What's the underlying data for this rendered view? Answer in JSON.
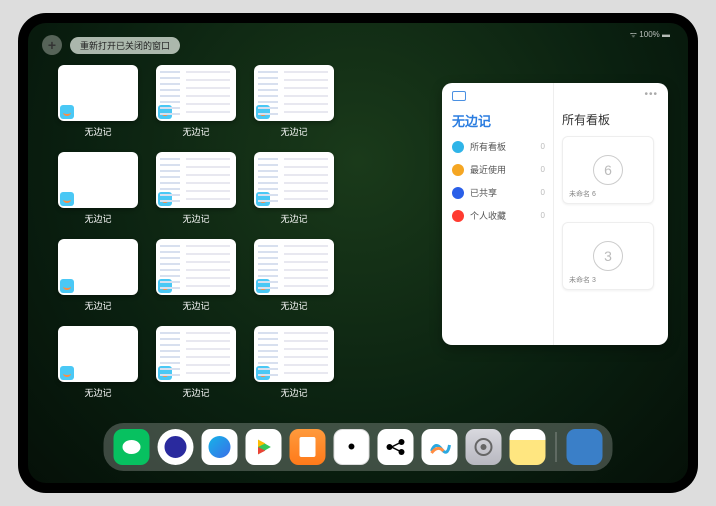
{
  "status": {
    "text": "100%"
  },
  "topbar": {
    "reopen_label": "重新打开已关闭的窗口"
  },
  "app_name": "无边记",
  "tiles": [
    {
      "label": "无边记",
      "variant": "plain"
    },
    {
      "label": "无边记",
      "variant": "detail"
    },
    {
      "label": "无边记",
      "variant": "detail"
    },
    {
      "label": "无边记",
      "variant": "plain"
    },
    {
      "label": "无边记",
      "variant": "detail"
    },
    {
      "label": "无边记",
      "variant": "detail"
    },
    {
      "label": "无边记",
      "variant": "plain"
    },
    {
      "label": "无边记",
      "variant": "detail"
    },
    {
      "label": "无边记",
      "variant": "detail"
    },
    {
      "label": "无边记",
      "variant": "plain"
    },
    {
      "label": "无边记",
      "variant": "detail"
    },
    {
      "label": "无边记",
      "variant": "detail"
    }
  ],
  "panel": {
    "left_title": "无边记",
    "right_title": "所有看板",
    "items": [
      {
        "icon": "grid",
        "color": "#2fb4e8",
        "label": "所有看板",
        "count": "0"
      },
      {
        "icon": "clock",
        "color": "#f5a623",
        "label": "最近使用",
        "count": "0"
      },
      {
        "icon": "share",
        "color": "#2a5fe8",
        "label": "已共享",
        "count": "0"
      },
      {
        "icon": "heart",
        "color": "#ff3b30",
        "label": "个人收藏",
        "count": "0"
      }
    ],
    "boards": [
      {
        "digit": "6",
        "name": "未命名 6"
      },
      {
        "digit": "3",
        "name": "未命名 3"
      }
    ]
  },
  "dock": {
    "apps": [
      "wechat",
      "browser",
      "qq",
      "play",
      "books",
      "dice",
      "dots",
      "freeform",
      "settings",
      "notes"
    ],
    "recent": [
      "folder"
    ]
  }
}
